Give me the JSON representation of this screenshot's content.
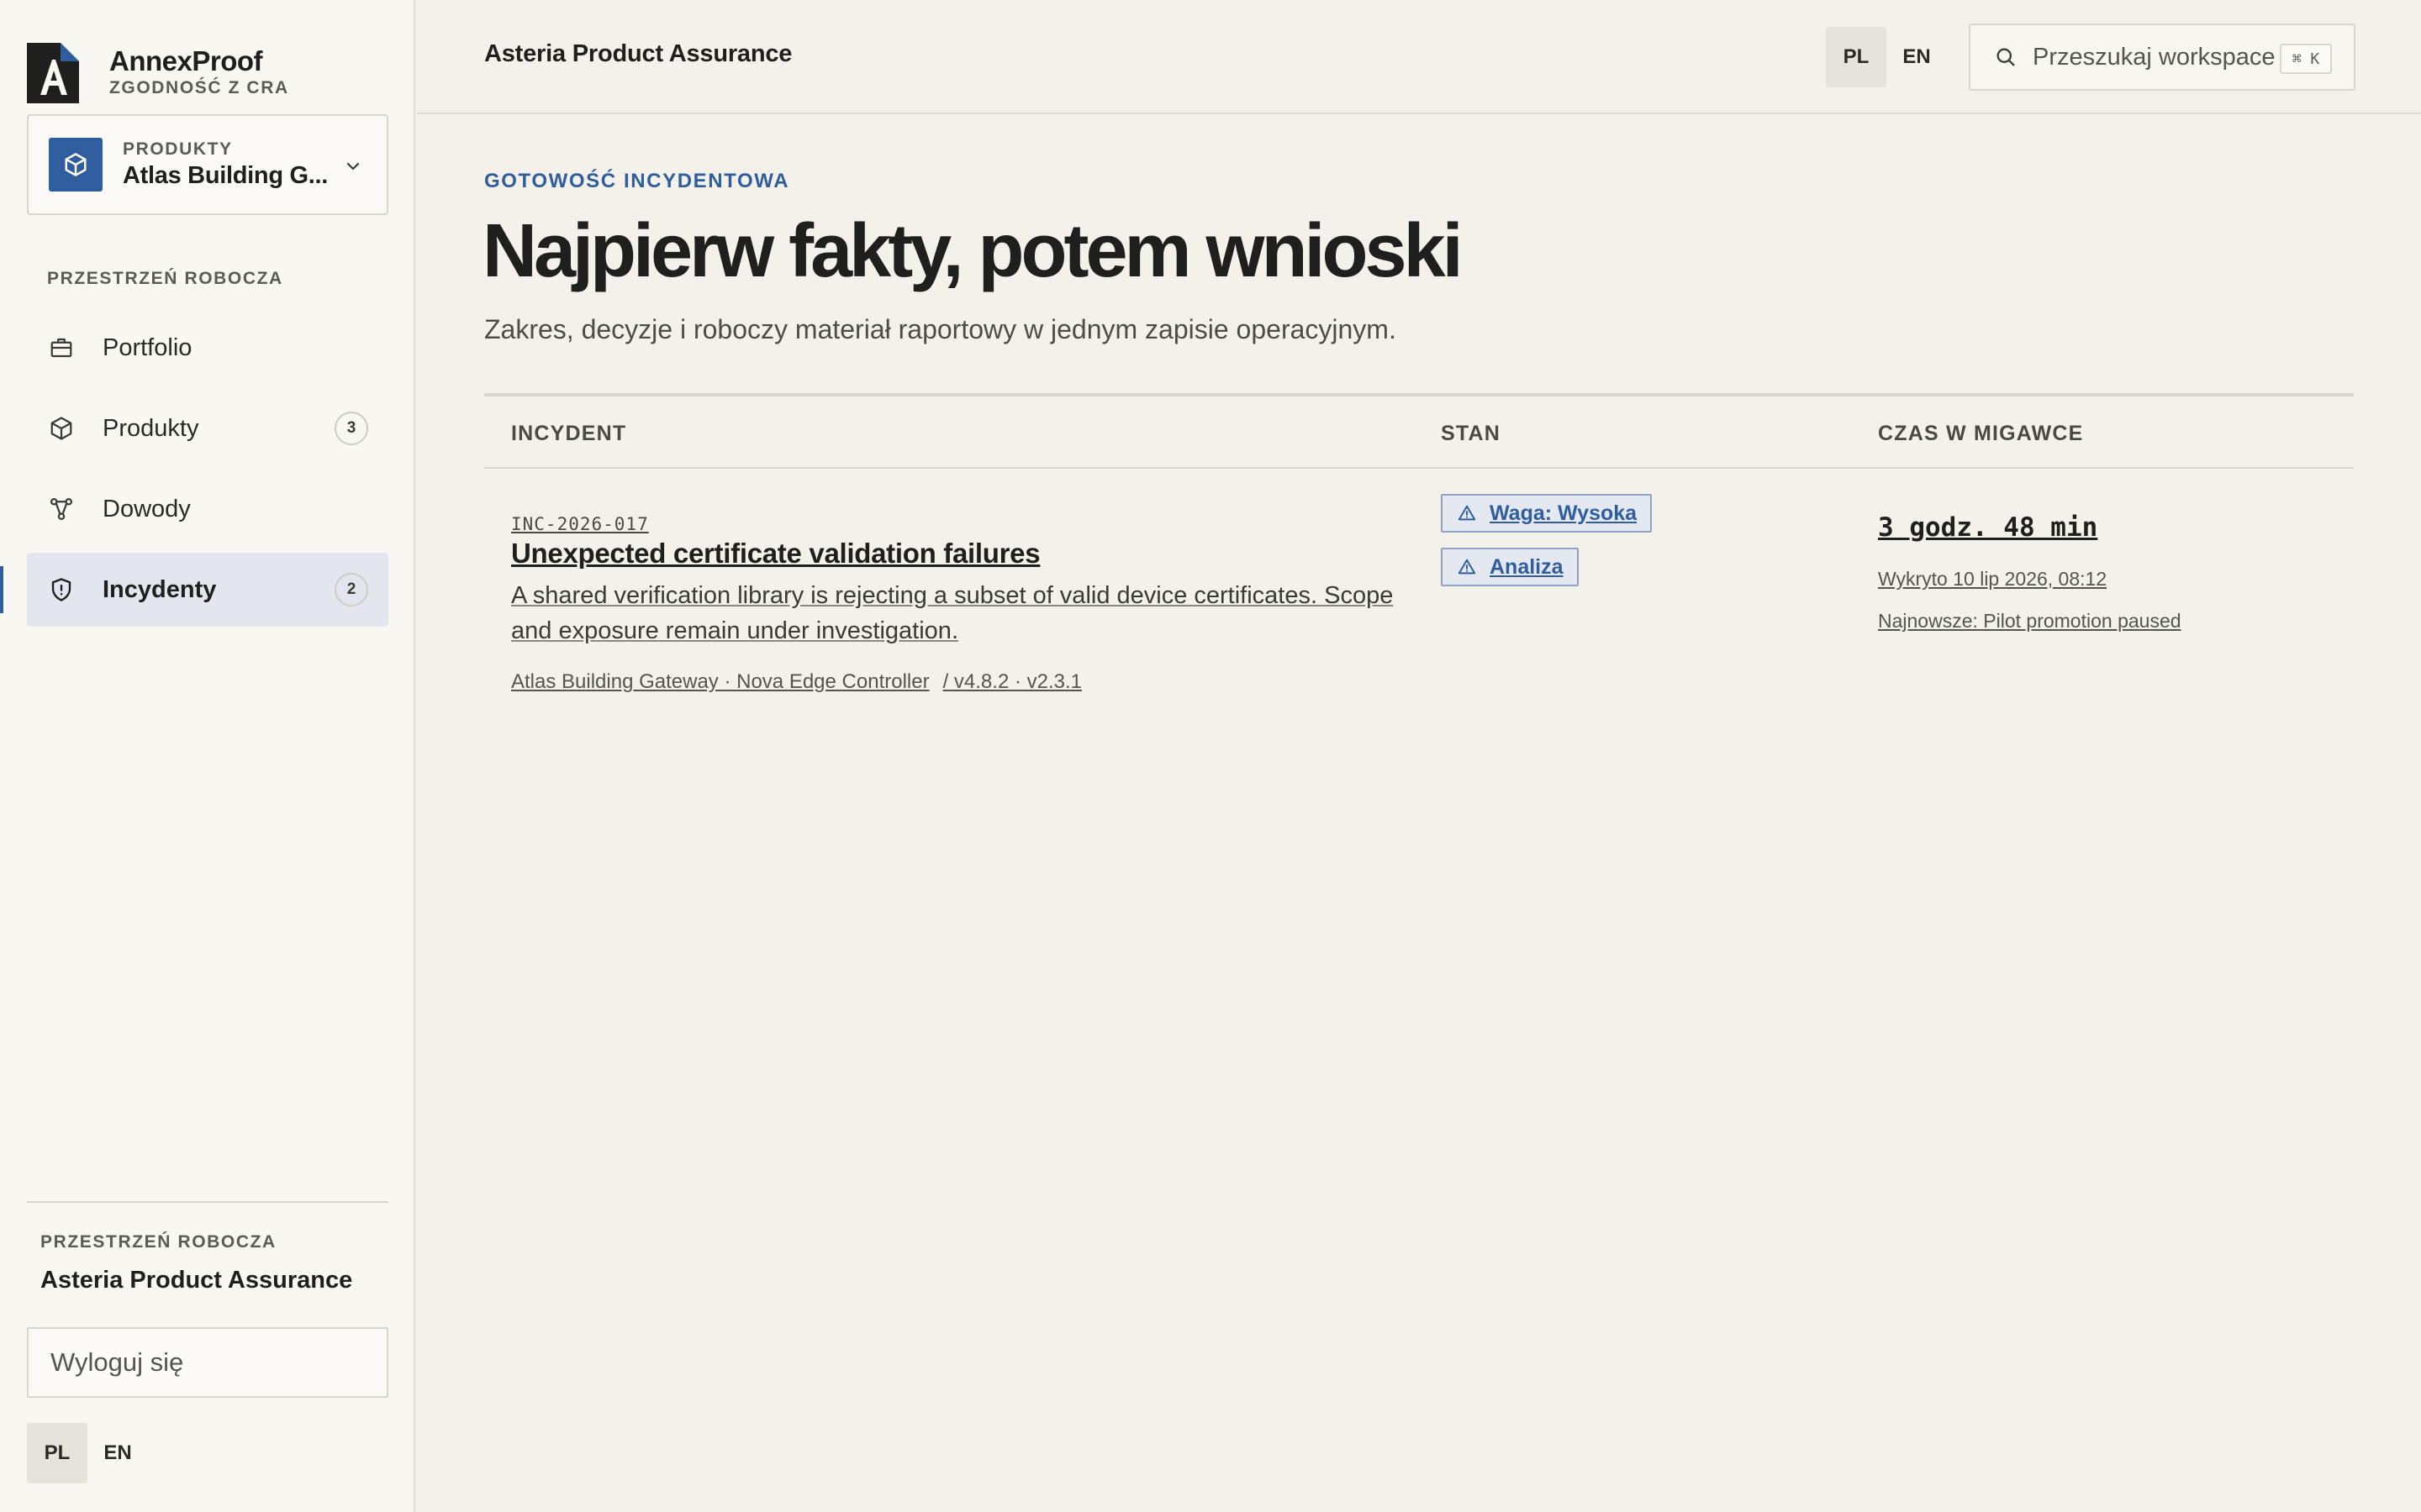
{
  "brand": {
    "name": "AnnexProof",
    "subtitle": "ZGODNOŚĆ Z CRA"
  },
  "product_selector": {
    "label": "PRODUKTY",
    "value": "Atlas Building G..."
  },
  "sidebar": {
    "section_label": "PRZESTRZEŃ ROBOCZA",
    "items": [
      {
        "label": "Portfolio",
        "icon": "briefcase-icon",
        "badge": null
      },
      {
        "label": "Produkty",
        "icon": "cube-icon",
        "badge": "3"
      },
      {
        "label": "Dowody",
        "icon": "graph-nodes-icon",
        "badge": null
      },
      {
        "label": "Incydenty",
        "icon": "shield-alert-icon",
        "badge": "2",
        "active": true
      }
    ],
    "workspace_label": "PRZESTRZEŃ ROBOCZA",
    "workspace_name": "Asteria Product Assurance",
    "logout_label": "Wyloguj się",
    "lang": {
      "pl": "PL",
      "en": "EN",
      "active": "PL"
    }
  },
  "topbar": {
    "title": "Asteria Product Assurance",
    "lang": {
      "pl": "PL",
      "en": "EN",
      "active": "PL"
    },
    "search": {
      "placeholder": "Przeszukaj workspace",
      "shortcut": "⌘ K"
    }
  },
  "main": {
    "eyebrow": "GOTOWOŚĆ INCYDENTOWA",
    "headline": "Najpierw fakty, potem wnioski",
    "lede": "Zakres, decyzje i roboczy materiał raportowy w jednym zapisie operacyjnym.",
    "table": {
      "columns": [
        "INCYDENT",
        "STAN",
        "CZAS W MIGAWCE"
      ],
      "rows": [
        {
          "id": "INC-2026-017",
          "title": "Unexpected certificate validation failures",
          "description": "A shared verification library is rejecting a subset of valid device certificates. Scope and exposure remain under investigation.",
          "products": "Atlas Building Gateway · Nova Edge Controller",
          "versions": "/ v4.8.2 · v2.3.1",
          "tags": [
            {
              "label": "Waga: Wysoka",
              "icon": "warning-triangle-icon"
            },
            {
              "label": "Analiza",
              "icon": "warning-triangle-icon"
            }
          ],
          "elapsed": "3 godz. 48 min",
          "detected": "Wykryto 10 lip 2026, 08:12",
          "latest": "Najnowsze: Pilot promotion paused"
        }
      ]
    }
  },
  "colors": {
    "accent": "#2f5d9e",
    "background": "#f3f1ea",
    "sidebar": "#f8f7f2",
    "active_nav": "#e3e6ee"
  }
}
